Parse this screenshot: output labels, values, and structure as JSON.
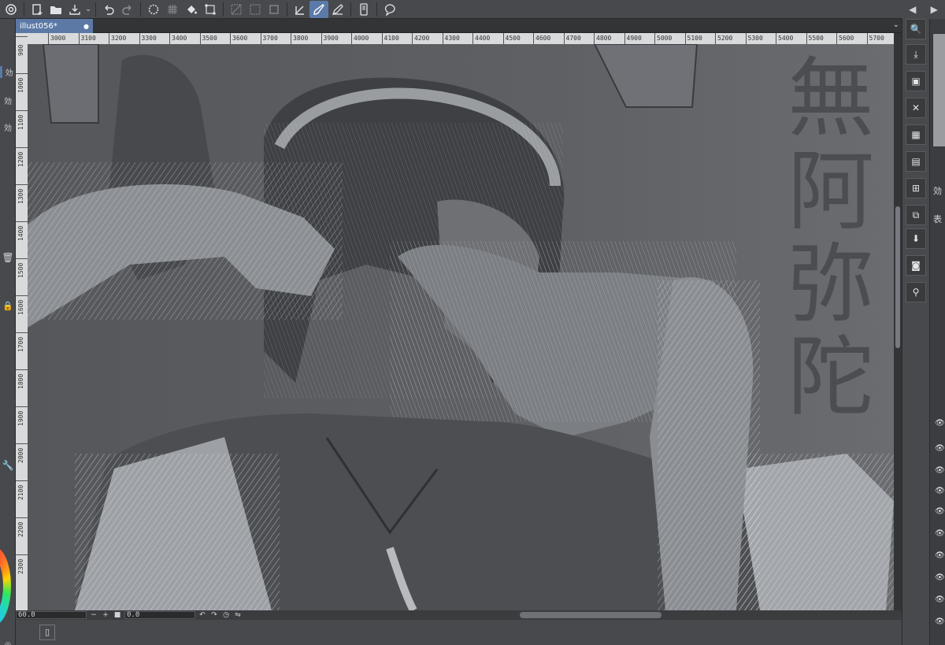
{
  "document": {
    "tab_title": "illust056*",
    "tab_modified_dot": "●"
  },
  "toolbar": {
    "icons": [
      "app-logo-icon",
      "new-file-icon",
      "open-folder-icon",
      "export-icon",
      "undo-icon",
      "redo-icon",
      "loading-icon",
      "grid-icon",
      "fill-icon",
      "transform-icon",
      "selection-off-icon",
      "selection-edge-icon",
      "selection-box-icon",
      "pen-draw-icon",
      "brush-active-icon",
      "pencil-icon",
      "tablet-icon",
      "speech-icon"
    ]
  },
  "right_top_nav": {
    "prev": "◀",
    "next": "▶"
  },
  "ruler": {
    "horizontal_labels": [
      "3000",
      "3100",
      "3200",
      "3300",
      "3400",
      "3500",
      "3600",
      "3700",
      "3800",
      "3900",
      "4000",
      "4100",
      "4200",
      "4300",
      "4400",
      "4500",
      "4600",
      "4700",
      "4800",
      "4900",
      "5000",
      "5100",
      "5200",
      "5300",
      "5400",
      "5500",
      "5600",
      "5700"
    ],
    "vertical_labels": [
      "900",
      "1000",
      "1100",
      "1200",
      "1300",
      "1400",
      "1500",
      "1600",
      "1700",
      "1800",
      "1900",
      "2000",
      "2100",
      "2200",
      "2300"
    ]
  },
  "canvas": {
    "background_kanji": [
      "無",
      "阿",
      "弥",
      "陀"
    ]
  },
  "status_bar": {
    "zoom_value": "60.0",
    "angle_value": "0.0",
    "zoom_out": "−",
    "zoom_in": "+",
    "fit": "■"
  },
  "left_strip": {
    "labels": [
      "効",
      "効",
      "効"
    ]
  },
  "right_panel": {
    "labels": [
      "効",
      "表"
    ]
  },
  "colors": {
    "accent": "#5c79a6",
    "toolbar_bg": "#47494c",
    "canvas_bg": "#5b5d61"
  }
}
